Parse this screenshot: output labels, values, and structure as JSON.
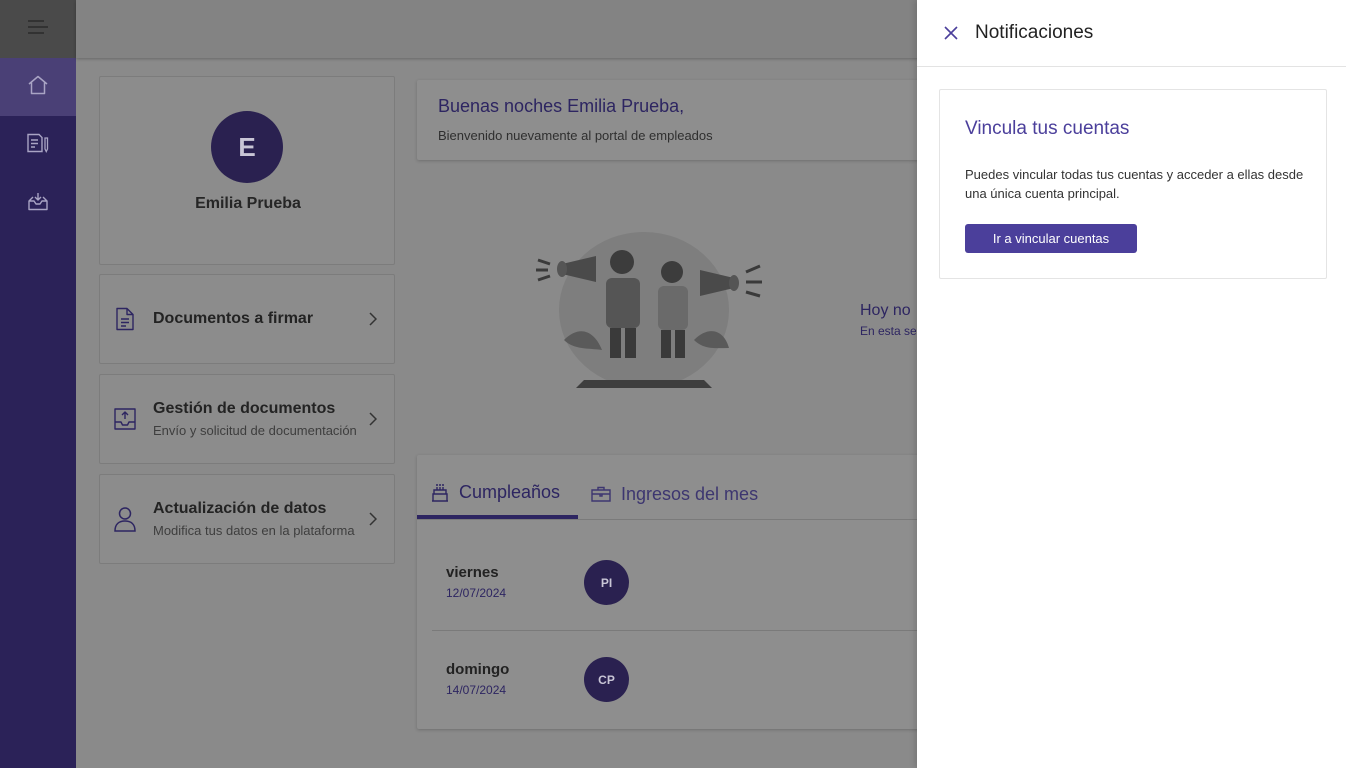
{
  "sidebar": {
    "items": [
      {
        "icon": "home-icon",
        "active": true
      },
      {
        "icon": "sign-document-icon",
        "active": false
      },
      {
        "icon": "inbox-icon",
        "active": false
      }
    ]
  },
  "profile": {
    "initial": "E",
    "name": "Emilia Prueba"
  },
  "menu_cards": [
    {
      "title": "Documentos a firmar",
      "subtitle": "",
      "icon": "document-icon"
    },
    {
      "title": "Gestión de documentos",
      "subtitle": "Envío y solicitud de documentación",
      "icon": "upload-tray-icon"
    },
    {
      "title": "Actualización de datos",
      "subtitle": "Modifica tus datos en la plataforma",
      "icon": "user-icon"
    }
  ],
  "greeting": {
    "title": "Buenas noches Emilia Prueba,",
    "subtitle": "Bienvenido nuevamente al portal de empleados"
  },
  "announcements": {
    "empty_title": "Hoy no h",
    "empty_subtitle": "En esta se"
  },
  "tabs": [
    {
      "label": "Cumpleaños",
      "icon": "cake-icon",
      "active": true
    },
    {
      "label": "Ingresos del mes",
      "icon": "briefcase-icon",
      "active": false
    }
  ],
  "birthdays": [
    {
      "day": "viernes",
      "date": "12/07/2024",
      "initials": "PI"
    },
    {
      "day": "domingo",
      "date": "14/07/2024",
      "initials": "CP"
    }
  ],
  "notifications": {
    "title": "Notificaciones",
    "card_title": "Vincula tus cuentas",
    "card_text": "Puedes vincular todas tus cuentas y acceder a ellas desde una única cuenta principal.",
    "button_label": "Ir a vincular cuentas"
  },
  "colors": {
    "primary": "#4b3f9b",
    "sidebar": "#2b2258",
    "overlay": "#8a8a8a"
  }
}
